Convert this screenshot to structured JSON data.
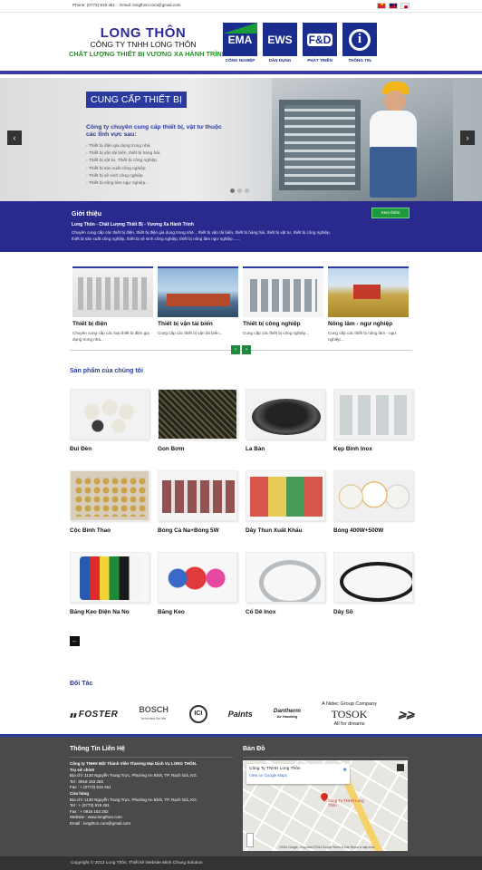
{
  "topbar": {
    "phone": "Phone: (0773) 919 451",
    "email": "Email: longthon.com@gmail.com"
  },
  "header": {
    "brand_name": "LONG THÔN",
    "company": "CÔNG TY TNHH LONG THÔN",
    "slogan_a": "CHẤT LƯỢNG THIẾT BỊ",
    "slogan_b": "VƯƠNG XA HÀNH TRÌNH",
    "tiles": [
      {
        "mark": "EMA",
        "label": "CÔNG NGHIỆP",
        "icon": "ema-logo"
      },
      {
        "mark": "EWS",
        "label": "DÂN DỤNG",
        "icon": "ews-logo"
      },
      {
        "mark": "F&D",
        "label": "PHÁT TRIỂN",
        "icon": "fd-logo"
      },
      {
        "mark": "i",
        "label": "THÔNG TIN",
        "icon": "info-icon"
      }
    ]
  },
  "slider": {
    "title": "CUNG CẤP THIẾT BỊ",
    "intro": "Công ty chuyên cung cấp thiết bị, vật tư thuộc các lĩnh vực sau:",
    "items": [
      "Thiết bị điện gia dụng trong nhà.",
      "Thiết bị vận tải biển, thiết bị hàng hải.",
      "Thiết bị vật tư, Thiết bị công nghiệp.",
      "Thiết bị sản xuất công nghiệp",
      "Thiết bị vệ sinh công nghiệp",
      "Thiết bị nông lâm ngư nghiệp..."
    ],
    "prev": "‹",
    "next": "›",
    "slide_count": 3,
    "active_slide": 1
  },
  "intro": {
    "heading": "Giới thiệu",
    "subheading": "Long Thôn - Chất Lượng Thiết Bị - Vương Xa Hành Trình",
    "text": "Chuyên cung cấp các thiết bị điện, thiết bị điện gia dụng trong nhà. , thiết bị vận tải biển, thiết bị hàng hải, thiết bị vật tư, thiết bị công nghiệp, thiết bị sản xuất công nghiệp, thiết bị vệ sinh công nghiệp, thiết bị nông lâm ngư nghiệp.......",
    "button": "Xem thêm"
  },
  "categories": [
    {
      "title": "Thiết bị điện",
      "desc": "Chuyên cung cấp các loại thiết bị điện gia dụng trong nhà..."
    },
    {
      "title": "Thiết bị vận tải biển",
      "desc": "Cung cấp các thiết bị vận tải biển..."
    },
    {
      "title": "Thiết bị công nghiệp",
      "desc": "Cung cấp các thiết bị công nghiệp..."
    },
    {
      "title": "Nông lâm - ngư nghiệp",
      "desc": "Cung cấp các thiết bị nông lâm - ngư nghiệp..."
    }
  ],
  "categories_nav": {
    "prev": "‹",
    "next": "›"
  },
  "products": {
    "heading": "Sản phẩm của chúng tôi",
    "items": [
      "Đui Đèn",
      "Gon Bơm",
      "La Bàn",
      "Kẹp Bình Inox",
      "Cộc Bình Thao",
      "Bóng Cà Na+Bóng 5W",
      "Dây Thun Xuất Khẩu",
      "Bóng 400W+500W",
      "Băng Keo Điện Na No",
      "Băng Keo",
      "Cổ Dê Inox",
      "Dây Sồ"
    ],
    "back": "←"
  },
  "partners": {
    "heading": "Đối Tác",
    "foster": "FOSTER",
    "bosch": "BOSCH",
    "bosch_tag": "Invented for life",
    "ici": "ICI",
    "paints": "Paints",
    "dantherm": "Dantherm",
    "dantherm_tag": "Air Handling",
    "tosok_tag_top": "A Nidec Group Company",
    "tosok": "TOSOK",
    "tosok_tag": "All for dreams"
  },
  "footer": {
    "contact_title": "Thông Tin Liên Hệ",
    "map_title": "Bản Đồ",
    "company": "Công ty TNHH Một Thành Viên Thương Mại Dịch Vụ LONG THÔN.",
    "hq_label": "Trụ sở chính",
    "hq_address": "Địa chỉ :1130 Nguyễn Trung Trực, Phường An Bình, TP. Rạch Giá, KG.",
    "hq_tel": "Tel   : 0918 163 282",
    "hq_fax": "Fax   : + (0773) 919 451",
    "store_label": "Cửa hàng",
    "store_address": "Địa chỉ :1130 Nguyễn Trung Trực, Phường An Bình, TP. Rạch Giá, KG.",
    "store_tel": "Tel   : + (0773) 919 451",
    "store_fax": "Fax   : + 0918 163 282",
    "website": "Website : www.longthon.com",
    "email": "Email   : longthon.com@gmail.com",
    "map_card_title": "Công Ty TNHH Long Thôn",
    "map_card_link": "View on Google Maps",
    "map_pin_label": "Công Ty TNHH Long Thôn",
    "map_attribution": "©2014 Google - Map data ©2014 Google   Terms of Use   Report a map error"
  },
  "copyright": "Copyright © 2013 Long Thôn. Thiết kế Website Minh Chung Solution"
}
